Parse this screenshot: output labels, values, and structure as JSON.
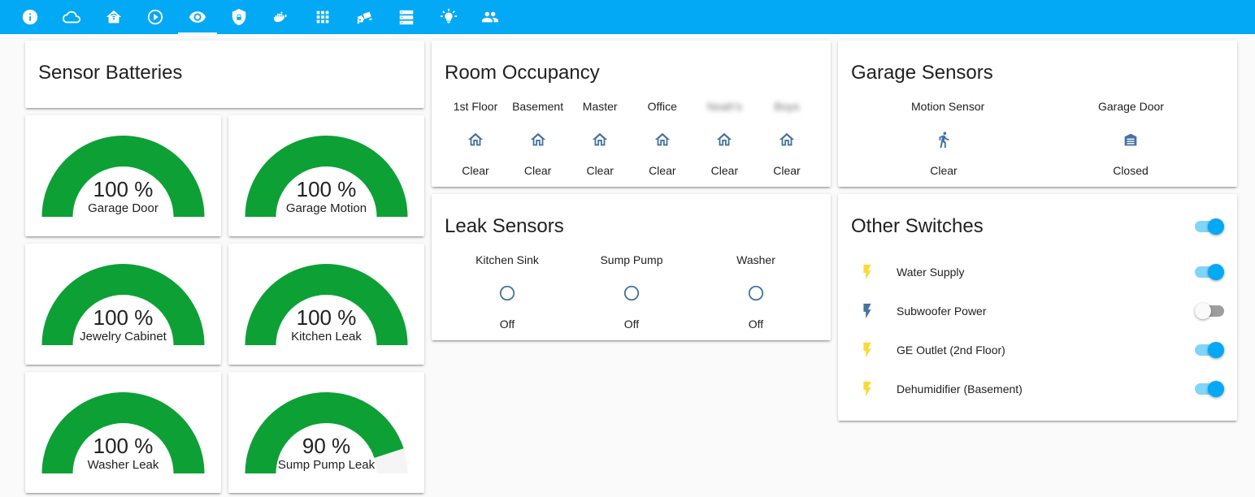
{
  "nav": {
    "tabs": [
      {
        "icon": "info-icon"
      },
      {
        "icon": "cloud-icon"
      },
      {
        "icon": "home-wifi-icon"
      },
      {
        "icon": "play-icon"
      },
      {
        "icon": "eye-icon",
        "active": true
      },
      {
        "icon": "shield-lock-icon"
      },
      {
        "icon": "docker-icon"
      },
      {
        "icon": "apps-grid-icon"
      },
      {
        "icon": "cctv-icon"
      },
      {
        "icon": "server-icon"
      },
      {
        "icon": "lightbulb-icon"
      },
      {
        "icon": "account-group-icon"
      }
    ],
    "bar_color": "#03a9f4"
  },
  "batteries": {
    "title": "Sensor Batteries",
    "gauge_color": "#0da035",
    "gauges": [
      {
        "value": "100 %",
        "name": "Garage Door",
        "level": 100
      },
      {
        "value": "100 %",
        "name": "Garage Motion",
        "level": 100
      },
      {
        "value": "100 %",
        "name": "Jewelry Cabinet",
        "level": 100
      },
      {
        "value": "100 %",
        "name": "Kitchen Leak",
        "level": 100
      },
      {
        "value": "100 %",
        "name": "Washer Leak",
        "level": 100
      },
      {
        "value": "90 %",
        "name": "Sump Pump Leak",
        "level": 90
      }
    ]
  },
  "occupancy": {
    "title": "Room Occupancy",
    "rooms": [
      {
        "label": "1st Floor",
        "state": "Clear",
        "icon": "home-outline-icon"
      },
      {
        "label": "Basement",
        "state": "Clear",
        "icon": "home-outline-icon"
      },
      {
        "label": "Master",
        "state": "Clear",
        "icon": "home-outline-icon"
      },
      {
        "label": "Office",
        "state": "Clear",
        "icon": "home-outline-icon"
      },
      {
        "label": "Noah's",
        "state": "Clear",
        "icon": "home-outline-icon",
        "blurred": true
      },
      {
        "label": "Boys",
        "state": "Clear",
        "icon": "home-outline-icon",
        "blurred": true
      }
    ]
  },
  "garage": {
    "title": "Garage Sensors",
    "items": [
      {
        "label": "Motion Sensor",
        "state": "Clear",
        "icon": "walk-icon"
      },
      {
        "label": "Garage Door",
        "state": "Closed",
        "icon": "garage-icon"
      }
    ]
  },
  "leak": {
    "title": "Leak Sensors",
    "items": [
      {
        "label": "Kitchen Sink",
        "state": "Off",
        "icon": "circle-outline-icon"
      },
      {
        "label": "Sump Pump",
        "state": "Off",
        "icon": "circle-outline-icon"
      },
      {
        "label": "Washer",
        "state": "Off",
        "icon": "circle-outline-icon"
      }
    ]
  },
  "switches": {
    "title": "Other Switches",
    "master_on": true,
    "items": [
      {
        "name": "Water Supply",
        "on": true,
        "icon": "flash-icon"
      },
      {
        "name": "Subwoofer Power",
        "on": false,
        "icon": "flash-icon"
      },
      {
        "name": "GE Outlet (2nd Floor)",
        "on": true,
        "icon": "flash-icon"
      },
      {
        "name": "Dehumidifier (Basement)",
        "on": true,
        "icon": "flash-icon"
      }
    ],
    "on_icon_color": "#fdd835",
    "off_icon_color": "#44739e"
  }
}
